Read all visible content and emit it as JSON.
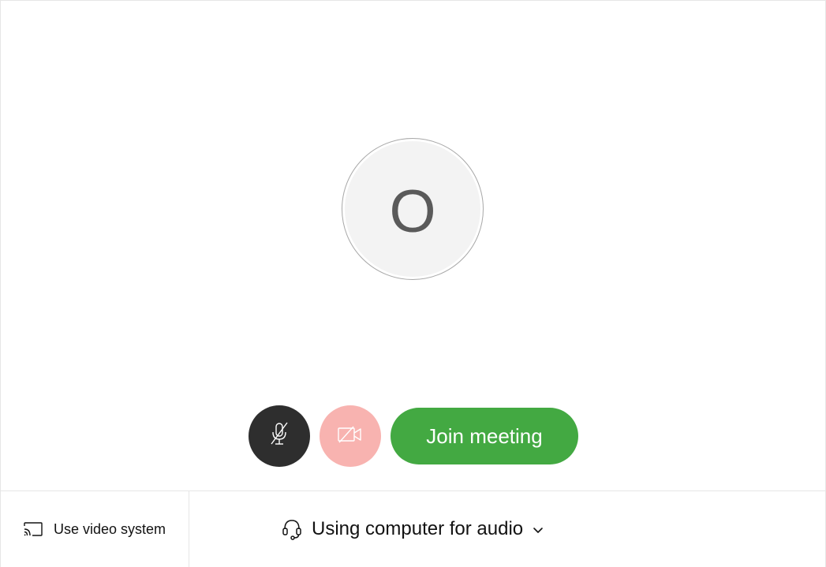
{
  "preview": {
    "avatar_initial": "O"
  },
  "controls": {
    "mute_icon": "microphone-muted-icon",
    "video_icon": "camera-off-icon",
    "join_label": "Join meeting"
  },
  "bottom_bar": {
    "video_system_icon": "cast-icon",
    "video_system_label": "Use video system",
    "audio_icon": "headset-icon",
    "audio_label": "Using computer for audio",
    "audio_chevron_icon": "chevron-down-icon"
  },
  "colors": {
    "join_green": "#43a942",
    "mute_dark": "#2e2e2e",
    "video_off_pink": "#f8b3b0",
    "avatar_bg": "#f3f3f3"
  }
}
